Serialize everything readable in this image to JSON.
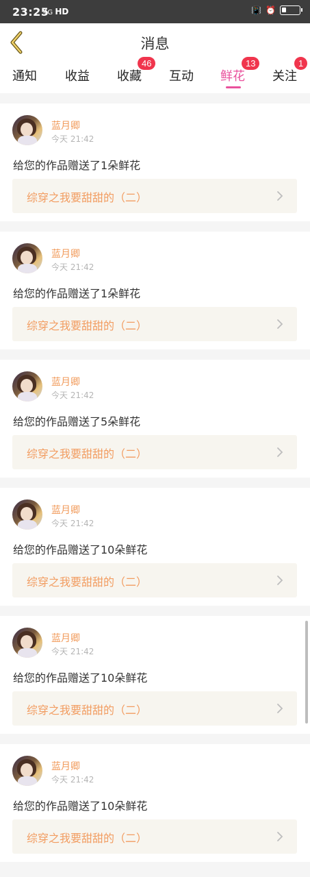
{
  "status": {
    "time": "23:25",
    "signal_text": "4G",
    "network_label": "HD"
  },
  "header": {
    "title": "消息"
  },
  "tabs": [
    {
      "label": "通知",
      "badge": ""
    },
    {
      "label": "收益",
      "badge": ""
    },
    {
      "label": "收藏",
      "badge": "46"
    },
    {
      "label": "互动",
      "badge": ""
    },
    {
      "label": "鲜花",
      "badge": "13",
      "active": true
    },
    {
      "label": "关注",
      "badge": "1"
    }
  ],
  "messages": [
    {
      "user": "蓝月卿",
      "time": "今天 21:42",
      "text": "给您的作品赠送了1朵鲜花",
      "work": "综穿之我要甜甜的（二）"
    },
    {
      "user": "蓝月卿",
      "time": "今天 21:42",
      "text": "给您的作品赠送了1朵鲜花",
      "work": "综穿之我要甜甜的（二）"
    },
    {
      "user": "蓝月卿",
      "time": "今天 21:42",
      "text": "给您的作品赠送了5朵鲜花",
      "work": "综穿之我要甜甜的（二）"
    },
    {
      "user": "蓝月卿",
      "time": "今天 21:42",
      "text": "给您的作品赠送了10朵鲜花",
      "work": "综穿之我要甜甜的（二）"
    },
    {
      "user": "蓝月卿",
      "time": "今天 21:42",
      "text": "给您的作品赠送了10朵鲜花",
      "work": "综穿之我要甜甜的（二）"
    },
    {
      "user": "蓝月卿",
      "time": "今天 21:42",
      "text": "给您的作品赠送了10朵鲜花",
      "work": "综穿之我要甜甜的（二）"
    }
  ],
  "colors": {
    "accent": "#e9519c",
    "badge": "#f0354d",
    "username": "#f19a5a",
    "work_title": "#f29c60"
  }
}
